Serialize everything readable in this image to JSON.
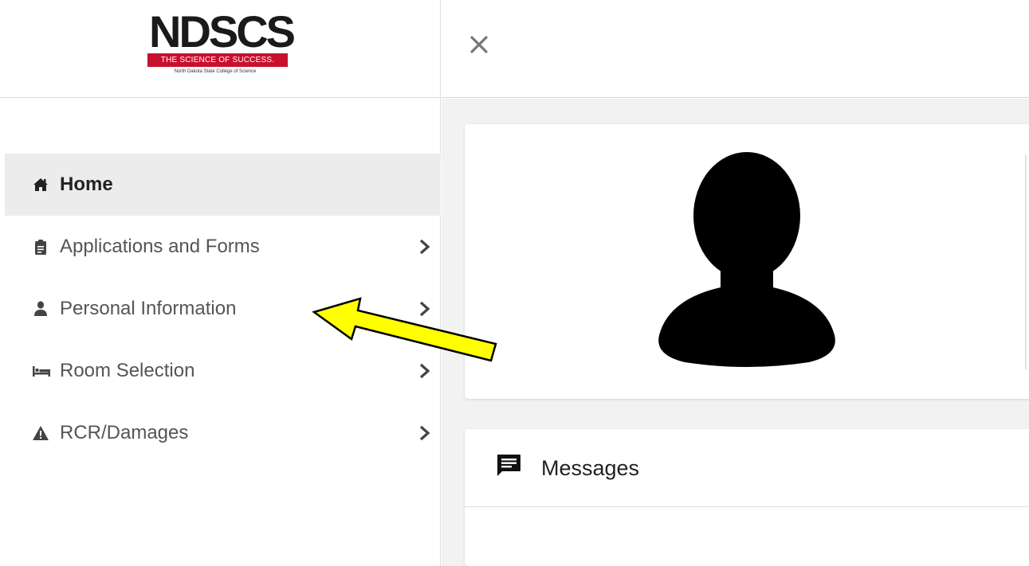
{
  "brand": {
    "logo_main": "NDSCS",
    "logo_tagline": "THE SCIENCE OF SUCCESS.",
    "logo_subtitle": "North Dakota State College of Science",
    "accent_color": "#c8102e"
  },
  "sidebar": {
    "items": [
      {
        "label": "Home",
        "icon": "home-icon",
        "active": true,
        "has_submenu": false
      },
      {
        "label": "Applications and Forms",
        "icon": "clipboard-icon",
        "active": false,
        "has_submenu": true
      },
      {
        "label": "Personal Information",
        "icon": "user-icon",
        "active": false,
        "has_submenu": true
      },
      {
        "label": "Room Selection",
        "icon": "bed-icon",
        "active": false,
        "has_submenu": true
      },
      {
        "label": "RCR/Damages",
        "icon": "warning-icon",
        "active": false,
        "has_submenu": true
      }
    ]
  },
  "topbar": {
    "close_icon": "close-icon"
  },
  "main": {
    "profile_card": {
      "avatar_icon": "avatar-silhouette-icon"
    },
    "messages": {
      "title": "Messages",
      "icon": "message-icon"
    }
  },
  "annotation": {
    "color": "#ffff00",
    "points_to": "Personal Information"
  }
}
